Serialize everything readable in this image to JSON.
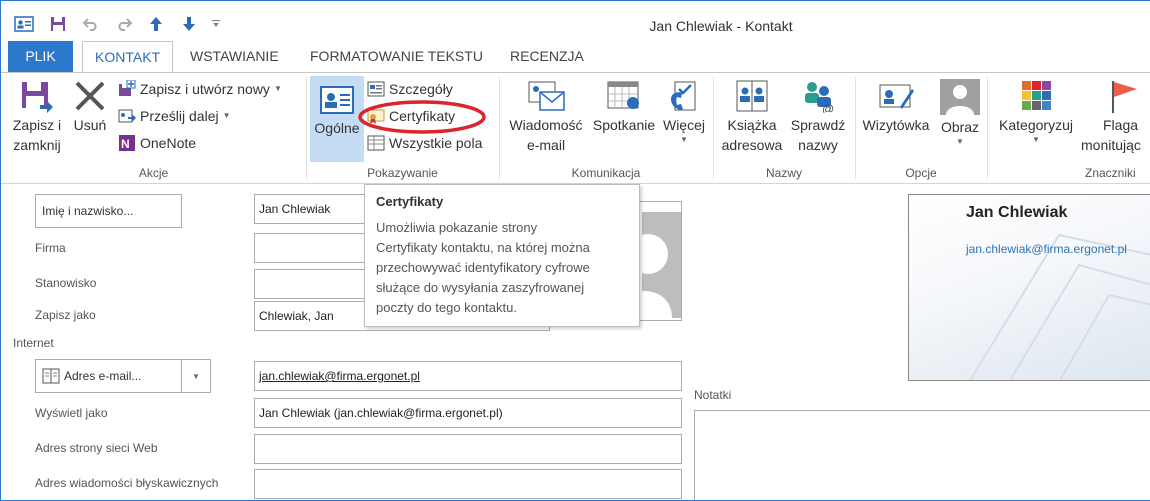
{
  "window": {
    "title": "Jan Chlewiak - Kontakt"
  },
  "tabs": [
    {
      "label": "PLIK"
    },
    {
      "label": "KONTAKT"
    },
    {
      "label": "WSTAWIANIE"
    },
    {
      "label": "FORMATOWANIE TEKSTU"
    },
    {
      "label": "RECENZJA"
    }
  ],
  "ribbon": {
    "akcje": {
      "label": "Akcje",
      "save_close": [
        "Zapisz i",
        "zamknij"
      ],
      "delete": "Usuń",
      "save_new": "Zapisz i utwórz nowy",
      "forward": "Prześlij dalej",
      "onenote": "OneNote"
    },
    "pokazywanie": {
      "label": "Pokazywanie",
      "general": "Ogólne",
      "details": "Szczegóły",
      "certificates": "Certyfikaty",
      "all_fields": "Wszystkie pola"
    },
    "komunikacja": {
      "label": "Komunikacja",
      "email": [
        "Wiadomość",
        "e-mail"
      ],
      "meeting": "Spotkanie",
      "more": "Więcej"
    },
    "nazwy": {
      "label": "Nazwy",
      "address_book": [
        "Książka",
        "adresowa"
      ],
      "check_names": [
        "Sprawdź",
        "nazwy"
      ]
    },
    "opcje": {
      "label": "Opcje",
      "business_card": "Wizytówka",
      "picture": "Obraz"
    },
    "znaczniki": {
      "label": "Znaczniki",
      "categorize": "Kategoryzuj",
      "followup": [
        "Flaga",
        "monitując"
      ]
    }
  },
  "tooltip": {
    "title": "Certyfikaty",
    "lines": [
      "Umożliwia pokazanie strony",
      "Certyfikaty kontaktu, na której można",
      "przechowywać identyfikatory cyfrowe",
      "służące do wysyłania zaszyfrowanej",
      "poczty do tego kontaktu."
    ]
  },
  "form": {
    "full_name_button": "Imię i nazwisko...",
    "full_name_value": "Jan Chlewiak",
    "company_label": "Firma",
    "company_value": "",
    "job_title_label": "Stanowisko",
    "job_title_value": "",
    "file_as_label": "Zapisz jako",
    "file_as_value": "Chlewiak, Jan",
    "internet_label": "Internet",
    "email_button": "Adres e-mail...",
    "email_value": "jan.chlewiak@firma.ergonet.pl",
    "display_as_label": "Wyświetl jako",
    "display_as_value": "Jan Chlewiak (jan.chlewiak@firma.ergonet.pl)",
    "web_label": "Adres strony sieci Web",
    "web_value": "",
    "im_label": "Adres wiadomości błyskawicznych",
    "im_value": "",
    "notes_label": "Notatki"
  },
  "business_card": {
    "name": "Jan Chlewiak",
    "email": "jan.chlewiak@firma.ergonet.pl"
  },
  "colors": {
    "accent": "#2b78cc",
    "highlight_ellipse": "#d9252b",
    "selected_button": "#c5dcf5"
  }
}
